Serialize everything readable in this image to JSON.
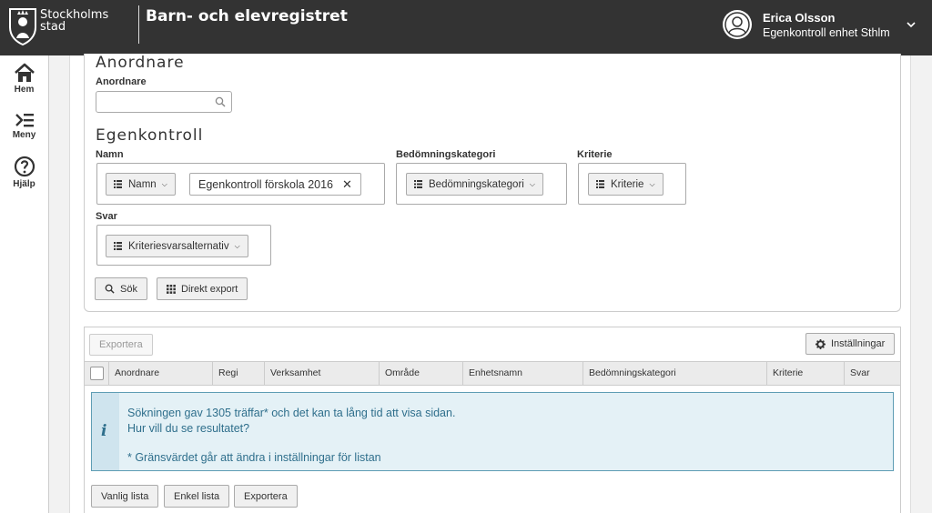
{
  "header": {
    "logo_text_line1": "Stockholms",
    "logo_text_line2": "stad",
    "app_title": "Barn- och elevregistret",
    "user_name": "Erica Olsson",
    "user_role": "Egenkontroll enhet Sthlm"
  },
  "nav": {
    "items": [
      {
        "label": "Hem",
        "icon": "home-icon"
      },
      {
        "label": "Meny",
        "icon": "menu-icon"
      },
      {
        "label": "Hjälp",
        "icon": "help-icon"
      }
    ]
  },
  "anordnare": {
    "title": "Anordnare",
    "field_label": "Anordnare",
    "input_value": ""
  },
  "egenkontroll": {
    "title": "Egenkontroll",
    "namn_label": "Namn",
    "namn_dropdown": "Namn",
    "namn_chip": "Egenkontroll förskola 2016",
    "bedomning_label": "Bedömningskategori",
    "bedomning_dropdown": "Bedömningskategori",
    "kriterie_label": "Kriterie",
    "kriterie_dropdown": "Kriterie",
    "svar_label": "Svar",
    "svar_dropdown": "Kriteriesvarsalternativ"
  },
  "actions": {
    "search": "Sök",
    "direct_export": "Direkt export"
  },
  "results": {
    "export_disabled": "Exportera",
    "settings": "Inställningar",
    "columns": [
      "Anordnare",
      "Regi",
      "Verksamhet",
      "Område",
      "Enhetsnamn",
      "Bedömningskategori",
      "Kriterie",
      "Svar"
    ],
    "info_line1": "Sökningen gav 1305 träffar* och det kan ta lång tid att visa sidan.",
    "info_line2": "Hur vill du se resultatet?",
    "info_note": "* Gränsvärdet går att ändra i inställningar för listan",
    "btn_normal": "Vanlig lista",
    "btn_simple": "Enkel lista",
    "btn_export": "Exportera"
  },
  "colors": {
    "header_bg": "#333333",
    "info_bg": "#e4f1f6",
    "info_text": "#2f6f8c"
  }
}
